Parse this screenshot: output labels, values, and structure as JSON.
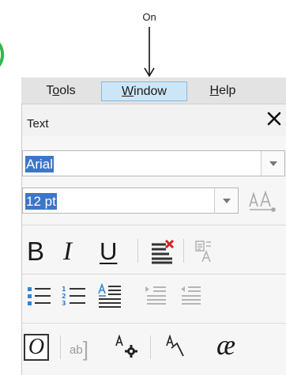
{
  "callout": {
    "label": "On"
  },
  "menubar": {
    "tools": {
      "pre": "T",
      "ul": "o",
      "post": "ols"
    },
    "window": {
      "pre": "",
      "ul": "W",
      "post": "indow"
    },
    "help": {
      "pre": "",
      "ul": "H",
      "post": "elp"
    }
  },
  "panel": {
    "title": "Text",
    "font_value": "Arial",
    "size_value": "12 pt"
  },
  "toolbar_row1": {
    "bold_glyph": "B",
    "italic_glyph": "I",
    "underline_glyph": "U"
  },
  "toolbar_row3": {
    "ab_text": "ab",
    "ab_bracket": "]",
    "ligature_glyph": "æ"
  },
  "icons": {
    "close": "close-icon",
    "aa": "font-size-aa-icon",
    "clear_format": "clear-formatting-icon",
    "text_case": "text-case-icon",
    "bullets": "bulleted-list-icon",
    "numbers": "numbered-list-icon",
    "para": "paragraph-text-icon",
    "indent_inc": "increase-indent-icon",
    "indent_dec": "decrease-indent-icon",
    "ab": "artistic-text-icon",
    "settings": "text-settings-icon",
    "kerning": "kerning-icon",
    "ligature": "ligature-icon"
  },
  "colors": {
    "accent": "#3c76c8",
    "menu_highlight": "#cde6f7",
    "clear_red": "#d92020",
    "list_blue": "#2e86d8"
  }
}
